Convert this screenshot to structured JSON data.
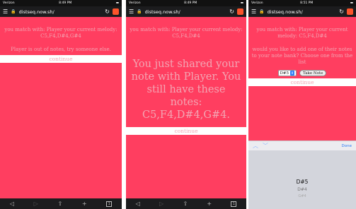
{
  "phone1": {
    "status": {
      "carrier": "Verizon",
      "time": "8:49 PM"
    },
    "url": "distseq.now.sh/",
    "match_message": "you match with: Player your current melody: C5,F4,D#4,G#4",
    "out_message": "Player is out of notes, try someone else.",
    "continue_label": "continue",
    "tab_count": "1"
  },
  "phone2": {
    "status": {
      "carrier": "Verizon",
      "time": "8:49 PM"
    },
    "url": "distseq.now.sh/",
    "match_message": "you match with: Player your current melody: C5,F4,D#4",
    "shared_message": "You just shared your note with Player. You still have these notes: C5,F4,D#4,G#4.",
    "continue_label": "continue",
    "tab_count": "1"
  },
  "phone3": {
    "status": {
      "carrier": "Verizon",
      "time": "8:51 PM"
    },
    "url": "distseq.now.sh/",
    "match_message": "you match with: Player your current melody: C5,F4,D#4",
    "question": "would you like to add one of their notes to your note bank? Choose one from the list",
    "select_value": "D#5",
    "take_note_label": "Take Note",
    "continue_label": "continue",
    "done_label": "Done",
    "picker_options": [
      "D#5",
      "D#4",
      "G#4"
    ]
  },
  "colors": {
    "page_bg": "#ff3e60",
    "text": "#f3a5b3",
    "bar": "#1c1c1e"
  }
}
